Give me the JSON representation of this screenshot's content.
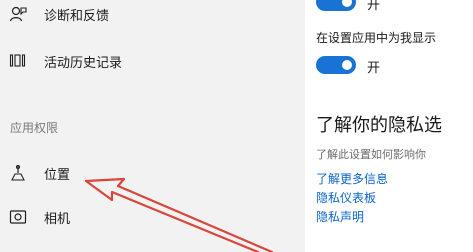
{
  "sidebar": {
    "items": [
      {
        "label": "诊断和反馈",
        "icon": "feedback-icon"
      },
      {
        "label": "活动历史记录",
        "icon": "timeline-icon"
      }
    ],
    "section_heading": "应用权限",
    "permission_items": [
      {
        "label": "位置",
        "icon": "location-icon"
      },
      {
        "label": "相机",
        "icon": "camera-icon"
      }
    ]
  },
  "content": {
    "top_toggle_state": "开",
    "setting_desc": "在设置应用中为我显示",
    "second_toggle_state": "开",
    "privacy_title": "了解你的隐私选",
    "privacy_sub": "了解此设置如何影响你",
    "links": [
      "了解更多信息",
      "隐私仪表板",
      "隐私声明"
    ]
  },
  "colors": {
    "accent": "#1a73d4",
    "annotation_arrow": "#d9473b"
  }
}
